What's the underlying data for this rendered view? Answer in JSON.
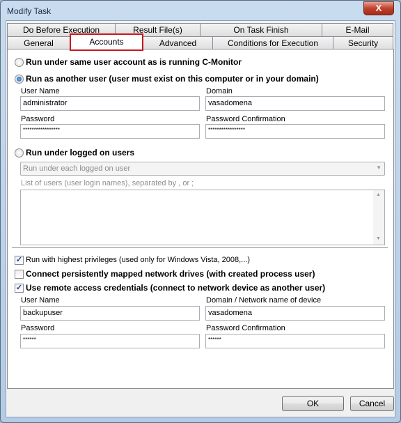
{
  "window": {
    "title": "Modify Task",
    "close_glyph": "X"
  },
  "tabs_row1": [
    {
      "label": "Do Before Execution"
    },
    {
      "label": "Result File(s)"
    },
    {
      "label": "On Task Finish"
    },
    {
      "label": "E-Mail"
    }
  ],
  "tabs_row2": [
    {
      "label": "General"
    },
    {
      "label": "Accounts",
      "selected": true
    },
    {
      "label": "Advanced"
    },
    {
      "label": "Conditions for Execution"
    },
    {
      "label": "Security"
    }
  ],
  "accounts": {
    "radio_same": {
      "label": "Run under same user account as is running C-Monitor",
      "checked": false
    },
    "radio_another": {
      "label": "Run as another user  (user must exist on this computer or in your domain)",
      "checked": true
    },
    "user_name_label": "User Name",
    "user_name": "administrator",
    "domain_label": "Domain",
    "domain": "vasadomena",
    "password_label": "Password",
    "password": "*****************",
    "password_conf_label": "Password Confirmation",
    "password_conf": "*****************",
    "radio_logged": {
      "label": "Run under logged on users",
      "checked": false
    },
    "logged_mode": "Run under each logged on user",
    "users_list_label": "List of users (user login names), separated by , or ;",
    "users_list": "",
    "cb_highest": {
      "label": "Run with highest privileges (used only for Windows Vista, 2008,...)",
      "checked": true
    },
    "cb_drives": {
      "label": "Connect persistently mapped network drives  (with created process user)",
      "checked": false
    },
    "cb_remote": {
      "label": "Use remote access credentials  (connect to network device as another user)",
      "checked": true
    },
    "remote_user_label": "User Name",
    "remote_user": "backupuser",
    "remote_domain_label": "Domain / Network name of device",
    "remote_domain": "vasadomena",
    "remote_password_label": "Password",
    "remote_password": "******",
    "remote_password_conf_label": "Password Confirmation",
    "remote_password_conf": "******"
  },
  "buttons": {
    "ok": "OK",
    "cancel": "Cancel"
  },
  "colors": {
    "selected_tab_highlight": "#c8171f"
  }
}
